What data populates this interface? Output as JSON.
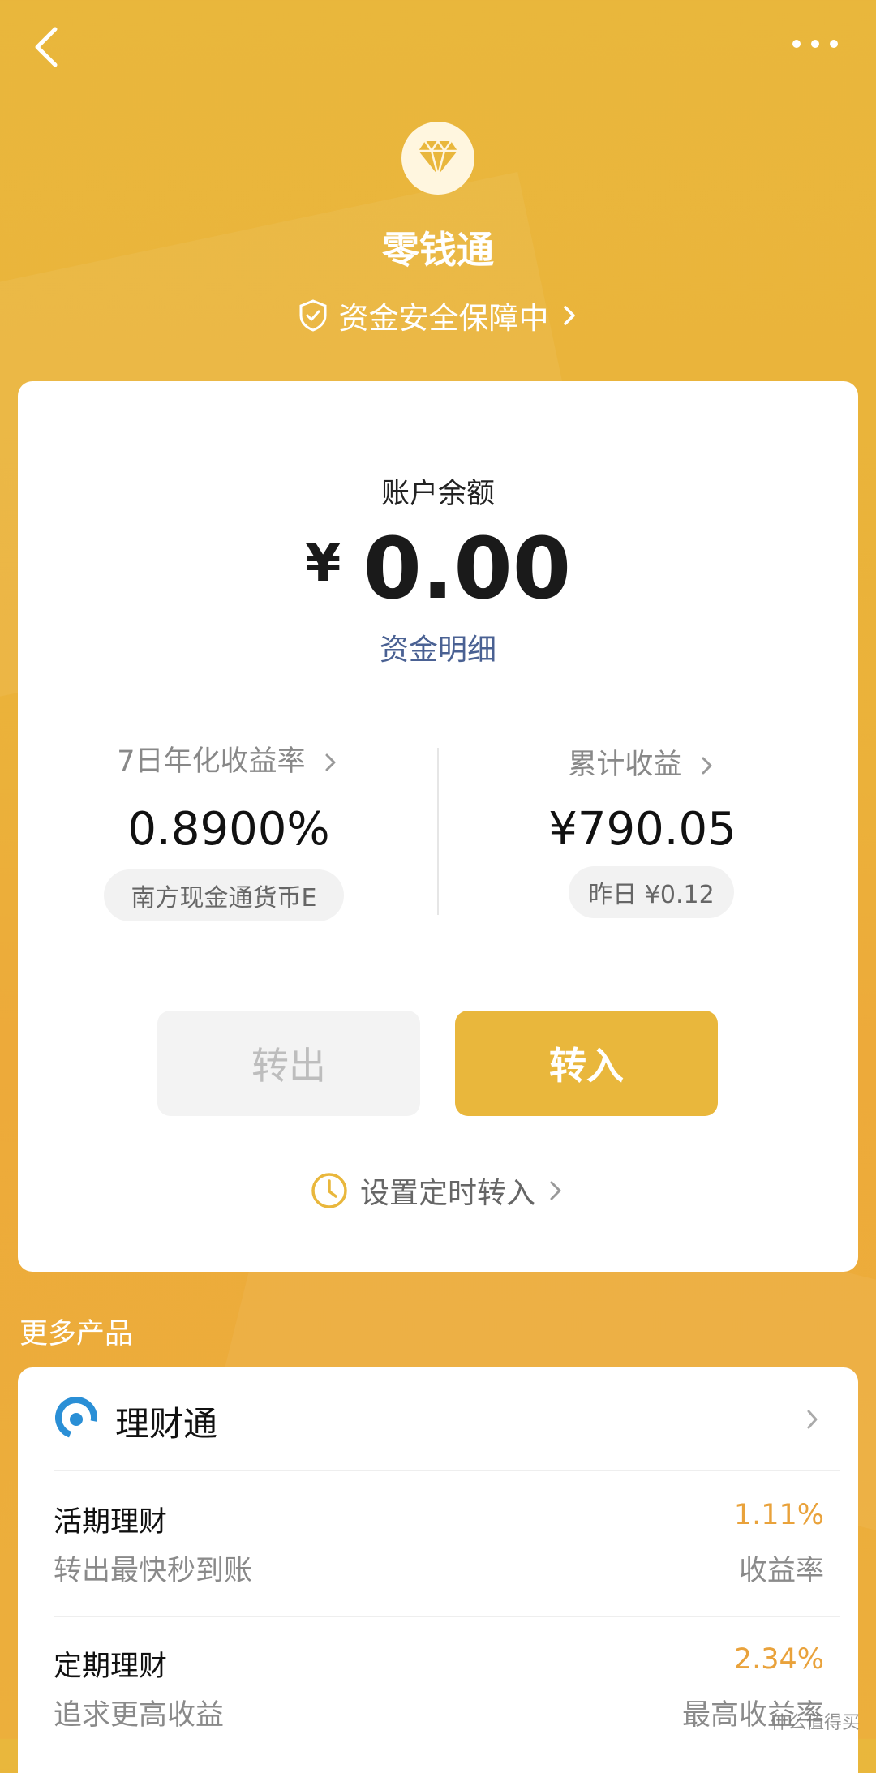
{
  "header": {
    "back_icon": "chevron-left-icon",
    "more_icon": "more-dots-icon",
    "logo_icon": "diamond-icon",
    "title": "零钱通",
    "security_text": "资金安全保障中"
  },
  "balance_card": {
    "label": "账户余额",
    "currency": "¥",
    "amount": "0.00",
    "details_link": "资金明细",
    "yield_label": "7日年化收益率",
    "yield_value": "0.8900%",
    "fund_name": "南方现金通货币E",
    "earnings_label": "累计收益",
    "earnings_value": "¥790.05",
    "yesterday": "昨日 ¥0.12",
    "transfer_out": "转出",
    "transfer_in": "转入",
    "schedule_link": "设置定时转入"
  },
  "more_products": {
    "section_title": "更多产品",
    "product_name": "理财通",
    "items": [
      {
        "title": "活期理财",
        "subtitle": "转出最快秒到账",
        "rate": "1.11%",
        "rate_label": "收益率"
      },
      {
        "title": "定期理财",
        "subtitle": "追求更高收益",
        "rate": "2.34%",
        "rate_label": "最高收益率"
      }
    ]
  },
  "watermark": "什么值得买",
  "colors": {
    "primary": "#E9B73C",
    "accent_text": "#4A6193",
    "rate_orange": "#E9A23B"
  }
}
